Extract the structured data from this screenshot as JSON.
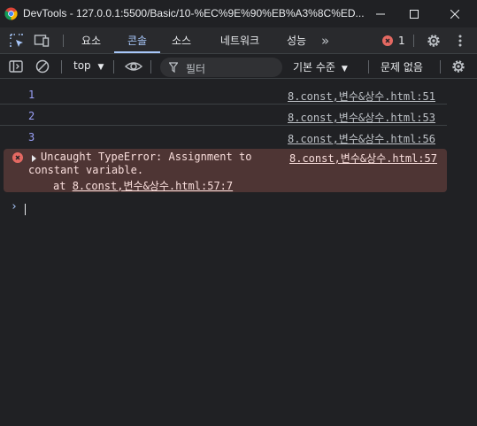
{
  "window": {
    "title": "DevTools - 127.0.0.1:5500/Basic/10-%EC%9E%90%EB%A3%8C%ED..."
  },
  "tabs": [
    {
      "label": "요소"
    },
    {
      "label": "콘솔"
    },
    {
      "label": "소스"
    },
    {
      "label": "네트워크"
    },
    {
      "label": "성능"
    }
  ],
  "issues_badge": {
    "count": "1"
  },
  "console_toolbar": {
    "context": "top",
    "filter_placeholder": "필터",
    "levels": "기본 수준",
    "issues": "문제 없음"
  },
  "logs": [
    {
      "message": "1",
      "source": "8.const,변수&상수.html:51"
    },
    {
      "message": "2",
      "source": "8.const,변수&상수.html:53"
    },
    {
      "message": "3",
      "source": "8.const,변수&상수.html:56"
    }
  ],
  "error": {
    "line1": "Uncaught TypeError: Assignment to",
    "line2": "constant variable.",
    "at": "at ",
    "at_link": "8.const,변수&상수.html:57:7",
    "source": "8.const,변수&상수.html:57"
  },
  "colors": {
    "background": "#202124",
    "accent": "#a8c7fa",
    "error": "#e46962",
    "error_bg": "#4e3534"
  }
}
